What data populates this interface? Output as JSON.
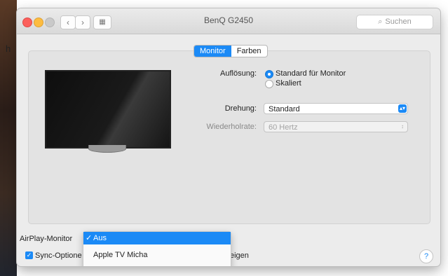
{
  "window": {
    "title": "BenQ G2450",
    "search_placeholder": "Suchen",
    "search_icon": "magnifier-icon",
    "nav_back": "‹",
    "nav_forward": "›",
    "grid_icon": "▦"
  },
  "tabs": [
    {
      "label": "Monitor",
      "active": true
    },
    {
      "label": "Farben",
      "active": false
    }
  ],
  "settings": {
    "resolution_label": "Auflösung:",
    "resolution_options": [
      {
        "label": "Standard für Monitor",
        "selected": true
      },
      {
        "label": "Skaliert",
        "selected": false
      }
    ],
    "rotation_label": "Drehung:",
    "rotation_value": "Standard",
    "refresh_label": "Wiederholrate:",
    "refresh_value": "60 Hertz"
  },
  "airplay": {
    "label": "AirPlay-Monitor",
    "menu_items": [
      {
        "label": "Aus",
        "checked": true,
        "highlighted": true
      },
      {
        "label": "Apple TV Micha",
        "checked": false,
        "highlighted": false
      }
    ],
    "checkmark": "✓"
  },
  "sync": {
    "label_left": "Sync-Optione",
    "label_right": "eigen",
    "checked": true
  },
  "help_label": "?",
  "edge_chars": {
    "top": "h",
    "bottom": "."
  },
  "colors": {
    "accent": "#1b8af6",
    "window_bg": "#ececec"
  }
}
